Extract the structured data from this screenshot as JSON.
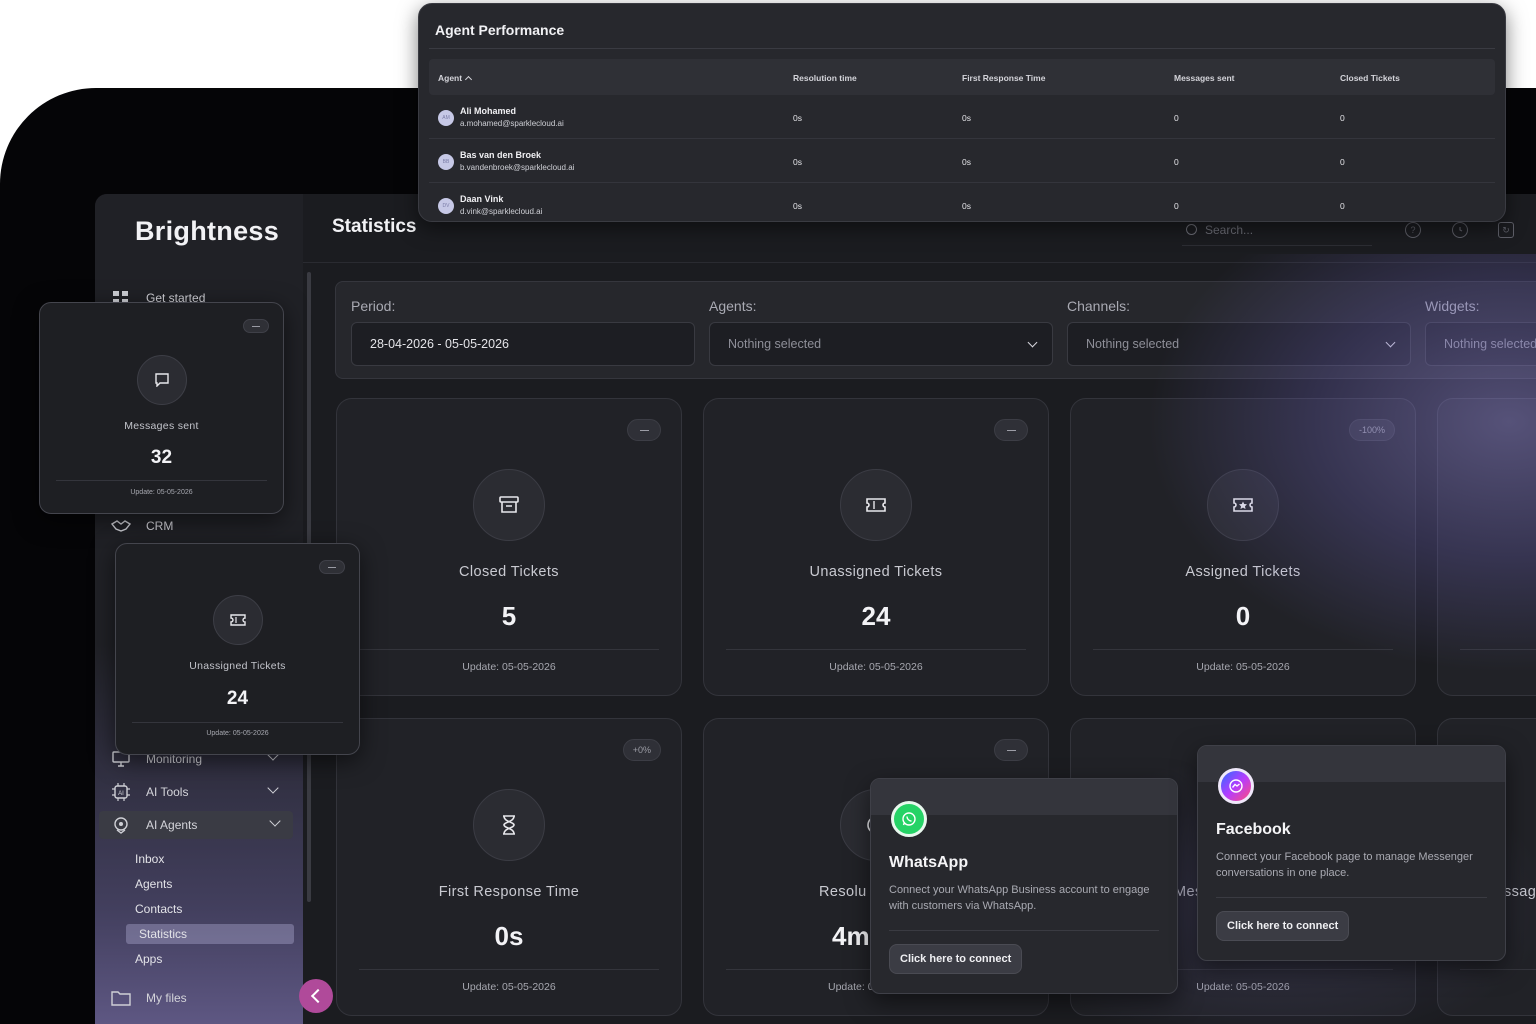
{
  "brand": {
    "logo": "Brightness",
    "accent": "#b04a9a"
  },
  "header": {
    "title": "Statistics",
    "search_placeholder": "Search..."
  },
  "sidebar": {
    "items": [
      {
        "label": "Get started",
        "icon": "grid-icon"
      },
      {
        "label": "CRM",
        "icon": "handshake-icon"
      },
      {
        "label": "Monitoring",
        "icon": "monitor-icon"
      },
      {
        "label": "AI Tools",
        "icon": "ai-chip-icon"
      },
      {
        "label": "AI Agents",
        "icon": "ai-agent-icon"
      },
      {
        "label": "My files",
        "icon": "folder-icon"
      }
    ],
    "sub_items": [
      "Inbox",
      "Agents",
      "Contacts",
      "Statistics",
      "Apps"
    ]
  },
  "filters": {
    "period": {
      "label": "Period:",
      "value": "28-04-2026 - 05-05-2026"
    },
    "agents": {
      "label": "Agents:",
      "value": "Nothing selected"
    },
    "channels": {
      "label": "Channels:",
      "value": "Nothing selected"
    },
    "widgets": {
      "label": "Widgets:",
      "value": "Nothing selected"
    }
  },
  "cards": [
    {
      "title": "Closed Tickets",
      "value": "5",
      "updated": "Update: 05-05-2026",
      "badge": "",
      "icon": "archive-box-icon"
    },
    {
      "title": "Unassigned Tickets",
      "value": "24",
      "updated": "Update: 05-05-2026",
      "badge": "",
      "icon": "ticket-icon"
    },
    {
      "title": "Assigned Tickets",
      "value": "0",
      "updated": "Update: 05-05-2026",
      "badge": "-100%",
      "icon": "assigned-ticket-icon"
    },
    {
      "title": "First Response Time",
      "value": "0s",
      "updated": "Update: 05-05-2026",
      "badge": "+0%",
      "icon": "hourglass-icon"
    },
    {
      "title": "Resolu",
      "value": "4m",
      "updated": "Update: 0",
      "badge": "",
      "icon": "clock-icon"
    },
    {
      "title": "",
      "value": "",
      "updated": "Update: 05-05-2026",
      "badge": "",
      "icon": ""
    }
  ],
  "edge_fragments": {
    "mes": "Mes",
    "ssag": "ssag"
  },
  "agent_performance": {
    "title": "Agent Performance",
    "columns": [
      "Agent",
      "Resolution time",
      "First Response Time",
      "Messages sent",
      "Closed Tickets"
    ],
    "rows": [
      {
        "initials": "AM",
        "name": "Ali Mohamed",
        "email": "a.mohamed@sparklecloud.ai",
        "resolution": "0s",
        "first_response": "0s",
        "messages": "0",
        "closed": "0"
      },
      {
        "initials": "BB",
        "name": "Bas van den Broek",
        "email": "b.vandenbroek@sparklecloud.ai",
        "resolution": "0s",
        "first_response": "0s",
        "messages": "0",
        "closed": "0"
      },
      {
        "initials": "DV",
        "name": "Daan Vink",
        "email": "d.vink@sparklecloud.ai",
        "resolution": "0s",
        "first_response": "0s",
        "messages": "0",
        "closed": "0"
      }
    ]
  },
  "floating_cards": [
    {
      "title": "Messages sent",
      "value": "32",
      "updated": "Update: 05-05-2026",
      "icon": "chat-bubble-icon"
    },
    {
      "title": "Unassigned Tickets",
      "value": "24",
      "updated": "Update: 05-05-2026",
      "icon": "ticket-icon"
    }
  ],
  "integrations": {
    "whatsapp": {
      "name": "WhatsApp",
      "description": "Connect your WhatsApp Business account to engage with customers via WhatsApp.",
      "button": "Click here to connect",
      "color": "#25d366"
    },
    "facebook": {
      "name": "Facebook",
      "description": "Connect your Facebook page to manage Messenger conversations in one place.",
      "button": "Click here to connect",
      "color": "#8a3ffc"
    }
  }
}
